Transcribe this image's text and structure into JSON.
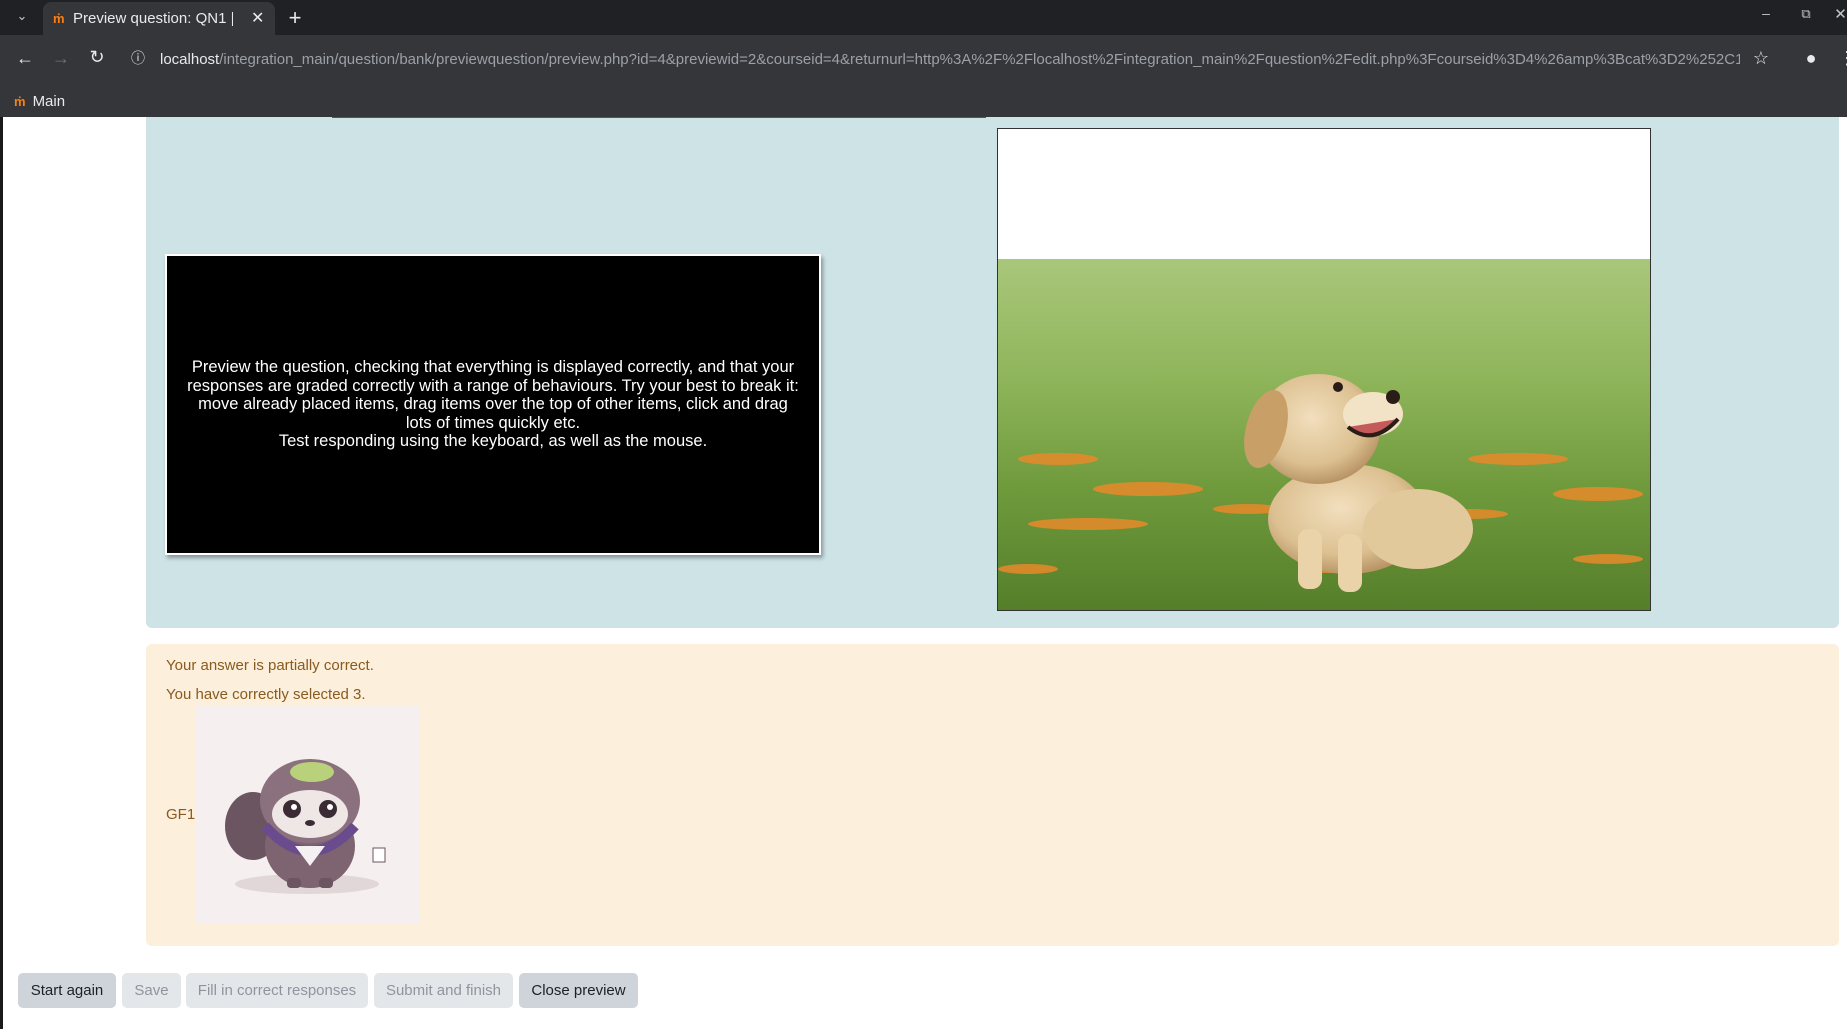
{
  "browser": {
    "tab_title": "Preview question: QN1 |",
    "tab_favicon": "moodle-icon",
    "url_host": "localhost",
    "url_path": "/integration_main/question/bank/previewquestion/preview.php?id=4&previewid=2&courseid=4&returnurl=http%3A%2F%2Flocalhost%2Fintegration_main%2Fquestion%2Fedit.php%3Fcourseid%3D4%26amp%3Bcat%3D2%252C199%26...",
    "bookmark_label": "Main"
  },
  "question": {
    "instructions_line1": "Preview the question, checking that everything is displayed correctly, and that your responses are graded correctly with a range of behaviours. Try your best to break it: move already placed items, drag items over the top of other items, click and drag lots of times quickly etc.",
    "instructions_line2": "Test responding using the keyboard, as well as the mouse."
  },
  "feedback": {
    "status": "Your answer is partially correct.",
    "detail": "You have correctly selected 3.",
    "item_label": "GF1"
  },
  "buttons": {
    "start_again": "Start again",
    "save": "Save",
    "fill_correct": "Fill in correct responses",
    "submit_finish": "Submit and finish",
    "close_preview": "Close preview"
  },
  "colors": {
    "question_bg": "#cde3e6",
    "feedback_bg": "#fcefdc",
    "feedback_text": "#8a5a1e"
  }
}
